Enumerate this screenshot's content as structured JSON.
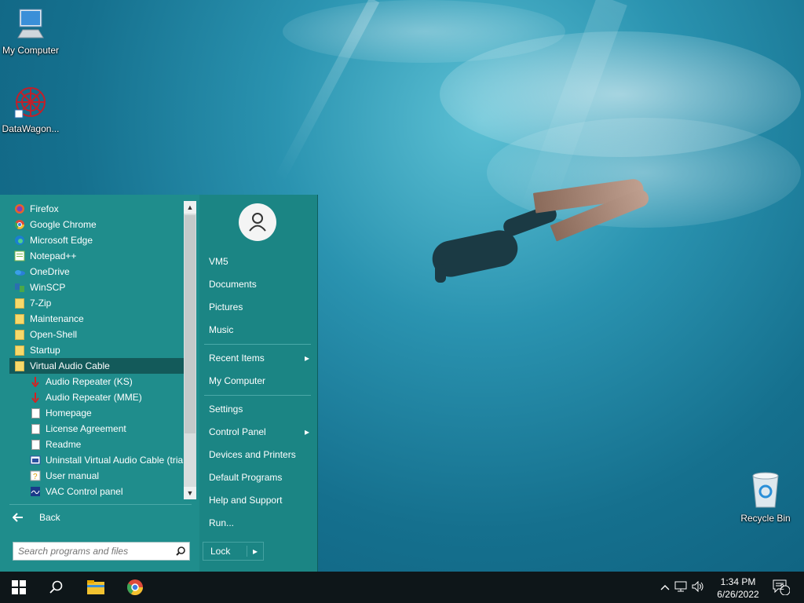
{
  "desktop": {
    "icons": [
      {
        "label": "My Computer",
        "icon": "monitor-icon"
      },
      {
        "label": "DataWagon...",
        "icon": "datawagon-icon"
      },
      {
        "label": "Recycle Bin",
        "icon": "recycle-bin-icon"
      }
    ]
  },
  "start_menu": {
    "programs": [
      {
        "label": "Firefox",
        "icon": "firefox-icon"
      },
      {
        "label": "Google Chrome",
        "icon": "chrome-icon"
      },
      {
        "label": "Microsoft Edge",
        "icon": "edge-icon"
      },
      {
        "label": "Notepad++",
        "icon": "notepadpp-icon"
      },
      {
        "label": "OneDrive",
        "icon": "onedrive-icon"
      },
      {
        "label": "WinSCP",
        "icon": "winscp-icon"
      },
      {
        "label": "7-Zip",
        "icon": "folder-icon"
      },
      {
        "label": "Maintenance",
        "icon": "folder-icon"
      },
      {
        "label": "Open-Shell",
        "icon": "folder-icon"
      },
      {
        "label": "Startup",
        "icon": "folder-icon"
      },
      {
        "label": "Virtual Audio Cable",
        "icon": "folder-icon"
      },
      {
        "label": "Audio Repeater (KS)",
        "icon": "audio-repeater-icon"
      },
      {
        "label": "Audio Repeater (MME)",
        "icon": "audio-repeater-icon"
      },
      {
        "label": "Homepage",
        "icon": "document-icon"
      },
      {
        "label": "License Agreement",
        "icon": "document-icon"
      },
      {
        "label": "Readme",
        "icon": "document-icon"
      },
      {
        "label": "Uninstall Virtual Audio Cable (trial",
        "icon": "uninstall-icon"
      },
      {
        "label": "User manual",
        "icon": "help-document-icon"
      },
      {
        "label": "VAC Control panel",
        "icon": "control-panel-icon"
      }
    ],
    "back_label": "Back",
    "search_placeholder": "Search programs and files",
    "right_items": [
      {
        "label": "VM5"
      },
      {
        "label": "Documents"
      },
      {
        "label": "Pictures"
      },
      {
        "label": "Music"
      },
      {
        "label": "Recent Items",
        "arrow": "▸"
      },
      {
        "label": "My Computer"
      },
      {
        "label": "Settings"
      },
      {
        "label": "Control Panel",
        "arrow": "▸"
      },
      {
        "label": "Devices and Printers"
      },
      {
        "label": "Default Programs"
      },
      {
        "label": "Help and Support"
      },
      {
        "label": "Run..."
      }
    ],
    "lock_label": "Lock",
    "lock_arrow": "▸"
  },
  "taskbar": {
    "clock_time": "1:34 PM",
    "clock_date": "6/26/2022",
    "notification_count": "2",
    "accent": "#1f8d8c"
  }
}
